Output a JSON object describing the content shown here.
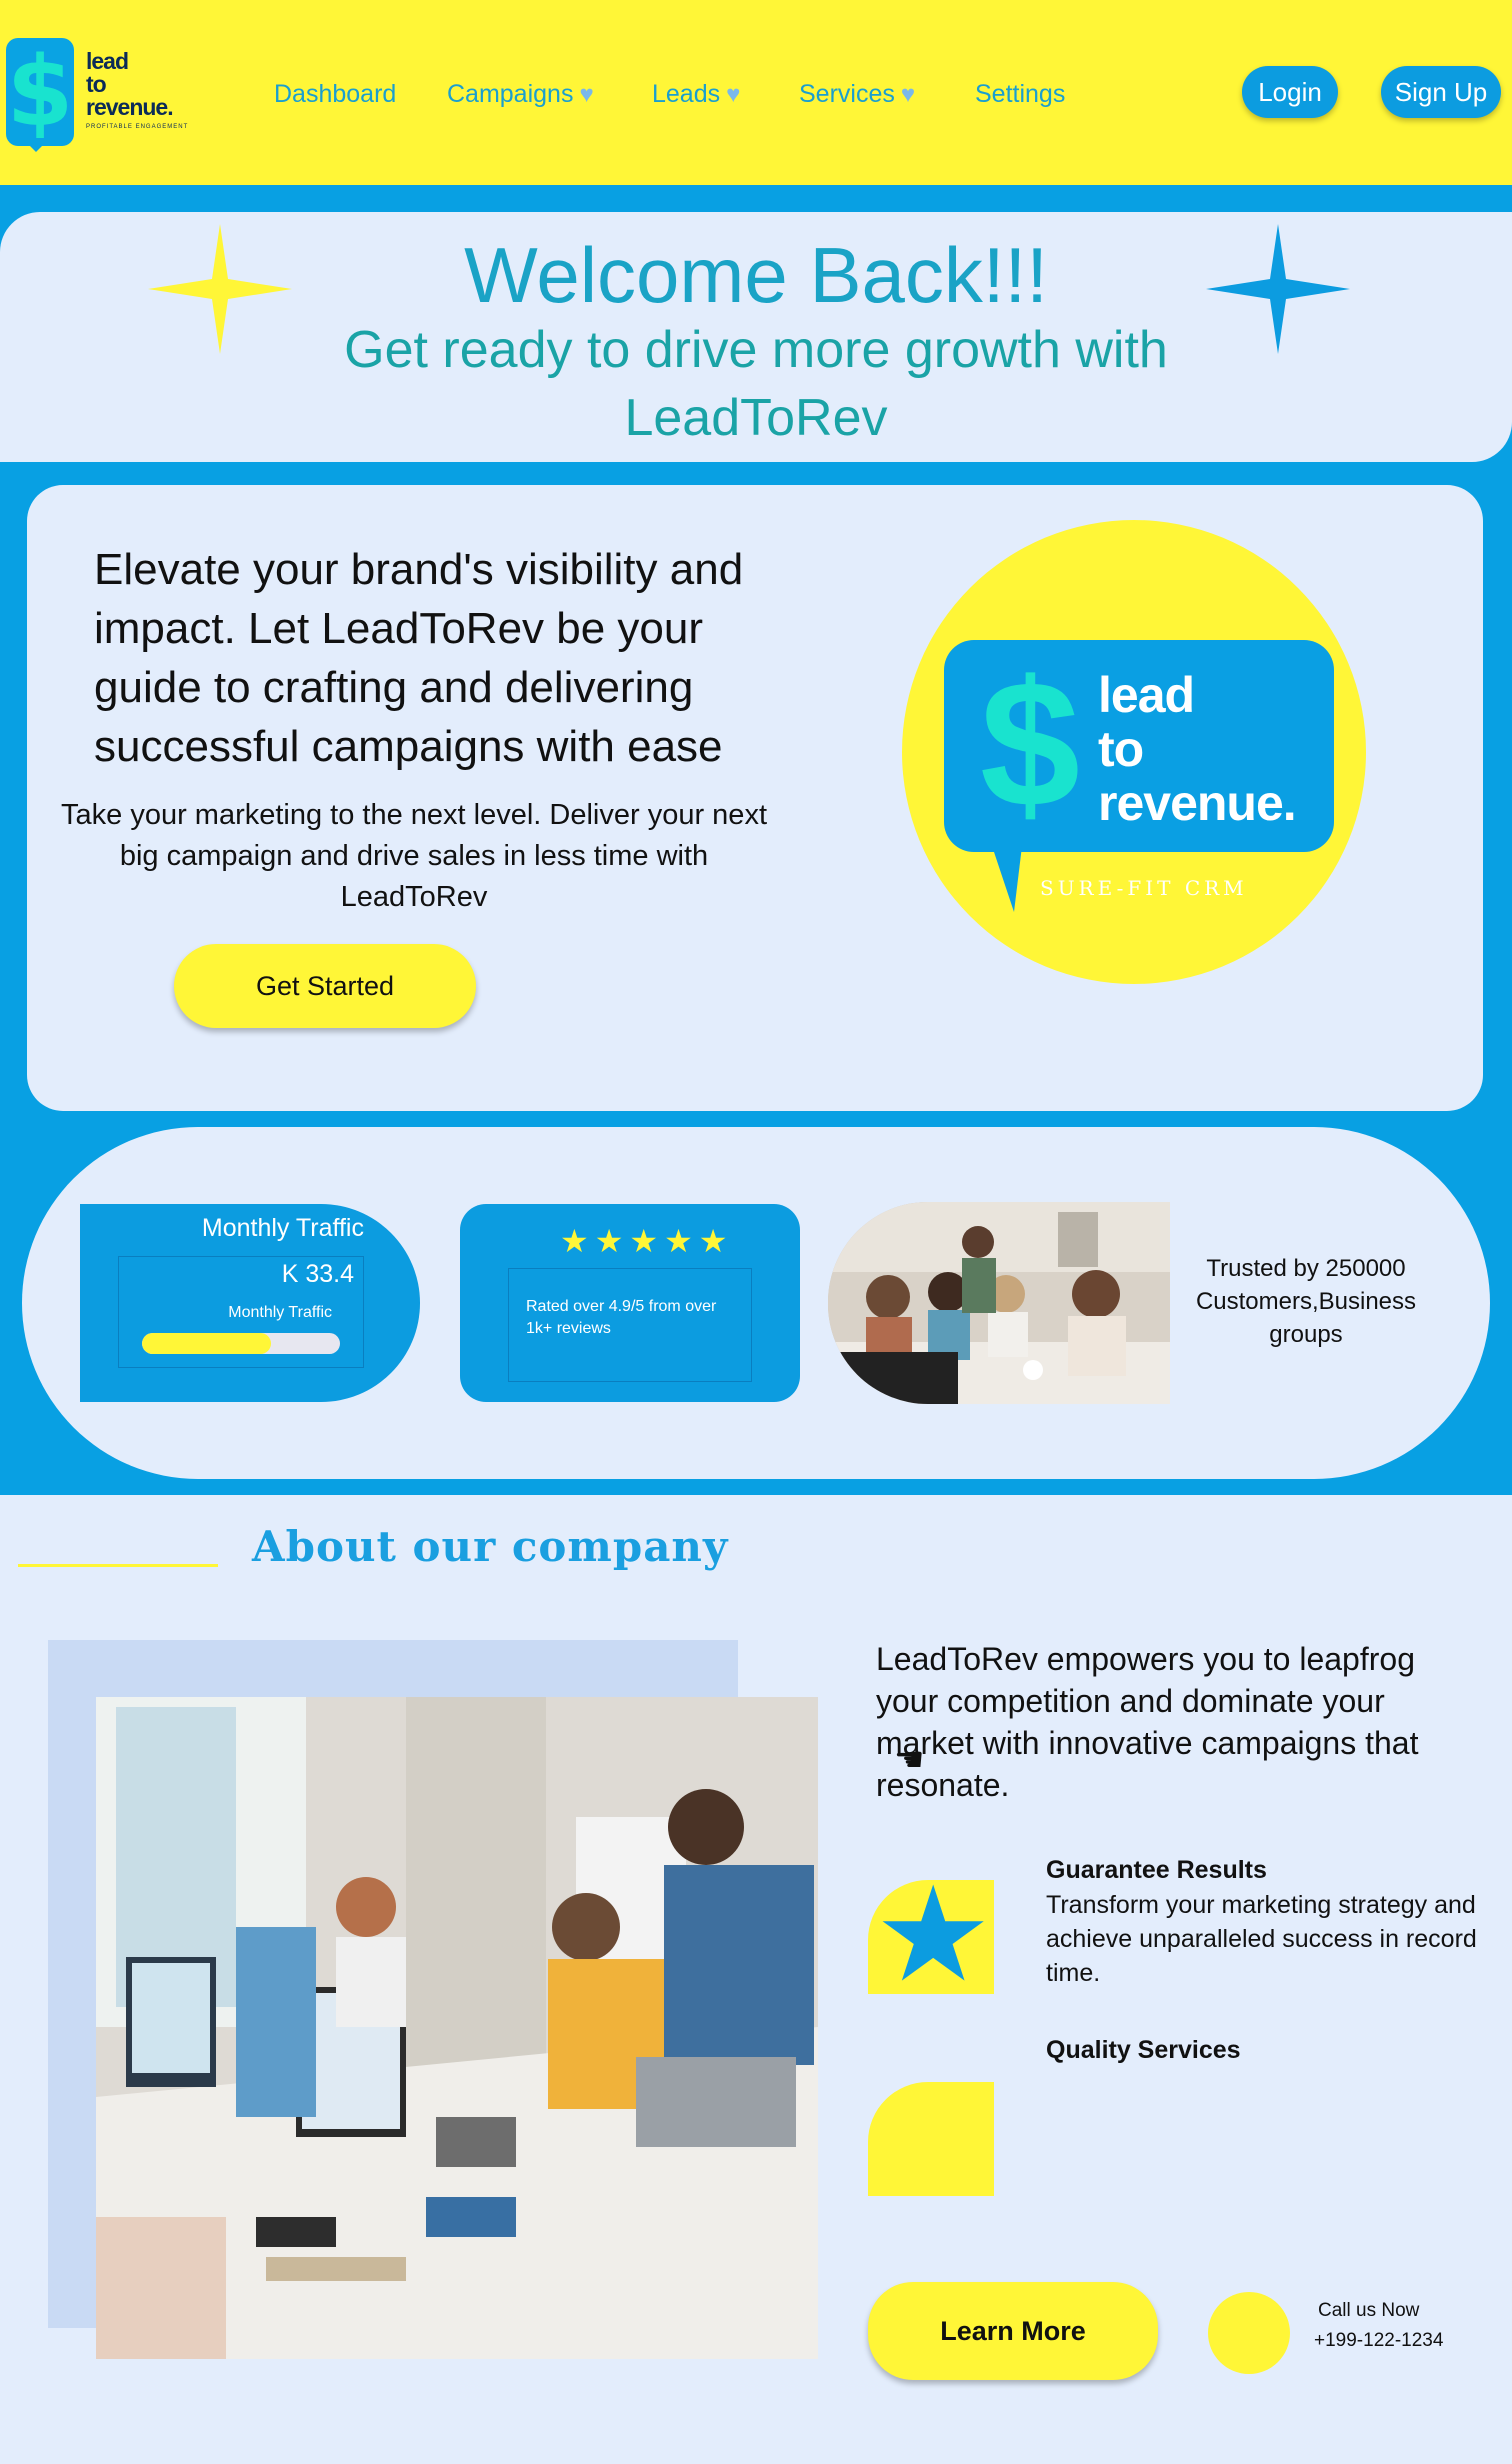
{
  "brand": {
    "logo_symbol": "$",
    "logo_text": [
      "lead",
      "to",
      "revenue."
    ],
    "logo_tagline": "PROFITABLE ENGAGEMENT",
    "colors": {
      "yellow": "#fff637",
      "blue": "#08a0e3",
      "teal": "#19e3cf",
      "page_bg": "#e3edfc"
    }
  },
  "nav": {
    "items": [
      {
        "label": "Dashboard",
        "dropdown": false
      },
      {
        "label": "Campaigns",
        "dropdown": true
      },
      {
        "label": "Leads",
        "dropdown": true
      },
      {
        "label": "Services",
        "dropdown": true
      },
      {
        "label": "Settings",
        "dropdown": false
      }
    ],
    "dropdown_icon": "heart-icon",
    "login_label": "Login",
    "signup_label": "Sign Up"
  },
  "welcome": {
    "title": "Welcome Back!!!",
    "subtitle": "Get ready to drive more growth with LeadToRev",
    "left_icon": "four-point-star-yellow-icon",
    "right_icon": "four-point-star-blue-icon"
  },
  "hero": {
    "headline": "Elevate your brand's visibility and impact. Let LeadToRev be your guide to crafting and delivering successful campaigns with ease",
    "body": "Take your marketing to the next level. Deliver your next big campaign and drive sales in less time with LeadToRev",
    "cta_label": "Get Started",
    "logo_symbol": "$",
    "logo_lines": [
      "lead",
      "to",
      "revenue."
    ],
    "logo_caption": "SURE-FIT CRM"
  },
  "stats": {
    "traffic_title": "Monthly Traffic",
    "traffic_value": "K 33.4",
    "traffic_label": "Monthly Traffic",
    "traffic_progress_pct": 65,
    "rating_stars": "★★★★★",
    "rating_text": "Rated over 4.9/5 from over 1k+ reviews",
    "trusted_text": "Trusted by 250000 Customers,Business groups"
  },
  "about": {
    "title": "About our company",
    "paragraph": "LeadToRev empowers you to leapfrog your competition and dominate your market with innovative campaigns that resonate.",
    "features": [
      {
        "title": "Guarantee Results",
        "description": "Transform your marketing strategy and achieve unparalleled success in record time.",
        "icon": "star-icon"
      },
      {
        "title": "Quality Services",
        "description": ""
      }
    ],
    "learn_more_label": "Learn More",
    "call_label": "Call us Now",
    "call_number": "+199-122-1234"
  }
}
